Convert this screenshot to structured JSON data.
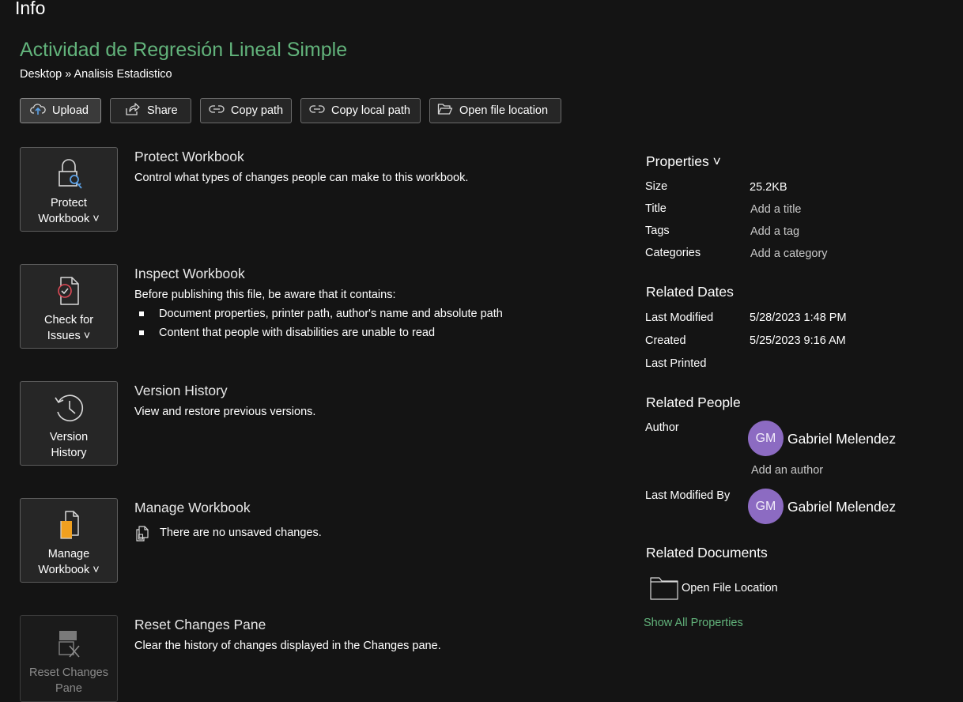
{
  "header": {
    "page_title": "Info",
    "document_title": "Actividad de Regresión Lineal Simple",
    "breadcrumb": "Desktop » Analisis Estadistico"
  },
  "toolbar": [
    {
      "label": "Upload",
      "icon": "upload-cloud-icon"
    },
    {
      "label": "Share",
      "icon": "share-icon"
    },
    {
      "label": "Copy path",
      "icon": "link-icon"
    },
    {
      "label": "Copy local path",
      "icon": "link-icon"
    },
    {
      "label": "Open file location",
      "icon": "folder-open-icon"
    }
  ],
  "sections": {
    "protect": {
      "card_line1": "Protect",
      "card_line2": "Workbook ˅",
      "icon": "lock-key-icon",
      "title": "Protect Workbook",
      "description": "Control what types of changes people can make to this workbook."
    },
    "inspect": {
      "card_line1": "Check for",
      "card_line2": "Issues ˅",
      "icon": "document-check-icon",
      "title": "Inspect Workbook",
      "description": "Before publishing this file, be aware that it contains:",
      "bullets": [
        "Document properties, printer path, author's name and absolute path",
        "Content that people with disabilities are unable to read"
      ]
    },
    "version": {
      "card_line1": "Version",
      "card_line2": "History",
      "icon": "history-clock-icon",
      "title": "Version History",
      "description": "View and restore previous versions."
    },
    "manage": {
      "card_line1": "Manage",
      "card_line2": "Workbook ˅",
      "icon": "manage-workbook-icon",
      "title": "Manage Workbook",
      "description": "There are no unsaved changes.",
      "description_icon": "document-copy-icon"
    },
    "reset": {
      "card_line1": "Reset Changes",
      "card_line2": "Pane",
      "icon": "reset-changes-icon",
      "title": "Reset Changes Pane",
      "description": "Clear the history of changes displayed in the Changes pane."
    }
  },
  "properties": {
    "heading": "Properties ˅",
    "size_label": "Size",
    "size_value": "25.2KB",
    "title_label": "Title",
    "title_value": "Add a title",
    "tags_label": "Tags",
    "tags_value": "Add a tag",
    "categories_label": "Categories",
    "categories_value": "Add a category"
  },
  "related_dates": {
    "heading": "Related Dates",
    "last_modified_label": "Last Modified",
    "last_modified_value": "5/28/2023 1:48 PM",
    "created_label": "Created",
    "created_value": "5/25/2023 9:16 AM",
    "last_printed_label": "Last Printed"
  },
  "related_people": {
    "heading": "Related People",
    "author_label": "Author",
    "author_initials": "GM",
    "author_name": "Gabriel Melendez",
    "add_author": "Add an author",
    "modified_by_label": "Last Modified By",
    "modified_by_initials": "GM",
    "modified_by_name": "Gabriel Melendez",
    "avatar_color": "#8c6bc2"
  },
  "related_documents": {
    "heading": "Related Documents",
    "open_location": "Open File Location",
    "show_all": "Show All Properties"
  },
  "colors": {
    "background": "#141414",
    "accent_green": "#62b37b",
    "card_background": "#262626"
  }
}
